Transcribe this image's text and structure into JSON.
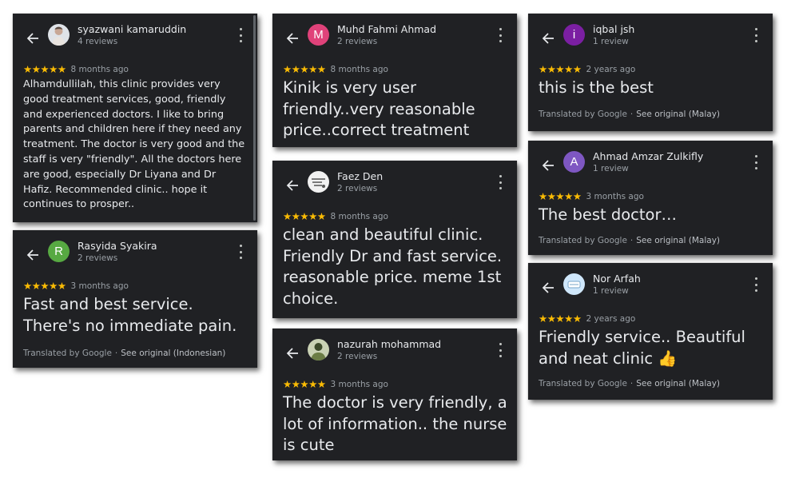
{
  "reviews": [
    {
      "name": "syazwani kamaruddin",
      "sub": "4 reviews",
      "avatar_letter": "",
      "avatar_bg": "#dfe3e8",
      "stars": "★★★★★",
      "time": "8 months ago",
      "text": "Alhamdullilah, this clinic provides very good treatment services, good, friendly and experienced doctors. I like to bring parents and children here if they need any treatment. The doctor is very good and the staff is very \"friendly\". All the doctors here are good, especially Dr Liyana and Dr Hafiz. Recommended clinic.. hope it continues to prosper.."
    },
    {
      "name": "Rasyida Syakira",
      "sub": "2 reviews",
      "avatar_letter": "R",
      "avatar_bg": "#57a942",
      "stars": "★★★★★",
      "time": "3 months ago",
      "text": "Fast and best service. There's no immediate pain.",
      "translated": "Translated by Google",
      "sep": "·",
      "original": "See original (Indonesian)"
    },
    {
      "name": "Muhd Fahmi Ahmad",
      "sub": "2 reviews",
      "avatar_letter": "M",
      "avatar_bg": "#e0427a",
      "stars": "★★★★★",
      "time": "8 months ago",
      "text": "Kinik is very user friendly..very reasonable price..correct treatment"
    },
    {
      "name": "Faez Den",
      "sub": "2 reviews",
      "avatar_letter": "",
      "avatar_bg": "#f1f1f1",
      "stars": "★★★★★",
      "time": "8 months ago",
      "text": "clean and beautiful clinic. Friendly Dr and fast service. reasonable price. meme 1st choice."
    },
    {
      "name": "nazurah mohammad",
      "sub": "2 reviews",
      "avatar_letter": "",
      "avatar_bg": "#c9d2b4",
      "stars": "★★★★★",
      "time": "3 months ago",
      "text": "The doctor is very friendly, a lot of information.. the nurse is cute"
    },
    {
      "name": "iqbal jsh",
      "sub": "1 review",
      "avatar_letter": "i",
      "avatar_bg": "#7b1fa2",
      "stars": "★★★★★",
      "time": "2 years ago",
      "text": "this is the best",
      "translated": "Translated by Google",
      "sep": "·",
      "original": "See original (Malay)"
    },
    {
      "name": "Ahmad Amzar Zulkifly",
      "sub": "1 review",
      "avatar_letter": "A",
      "avatar_bg": "#7e57c2",
      "stars": "★★★★★",
      "time": "3 months ago",
      "text": "The best doctor…",
      "translated": "Translated by Google",
      "sep": "·",
      "original": "See original (Malay)"
    },
    {
      "name": "Nor Arfah",
      "sub": "1 review",
      "avatar_letter": "",
      "avatar_bg": "#cfe7fb",
      "stars": "★★★★★",
      "time": "2 years ago",
      "text": "Friendly service.. Beautiful and neat clinic 👍",
      "translated": "Translated by Google",
      "sep": "·",
      "original": "See original (Malay)"
    }
  ]
}
